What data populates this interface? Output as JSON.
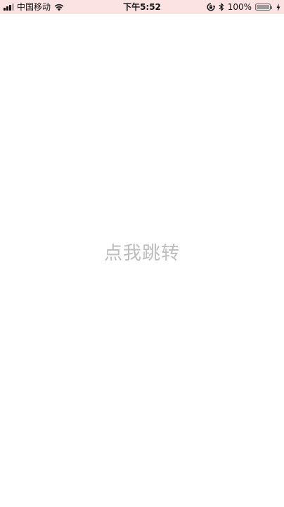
{
  "status_bar": {
    "carrier": "中国移动",
    "time": "下午5:52",
    "battery_percent": "100%",
    "signal_level": 3,
    "battery_level": 1.0,
    "icons": [
      "signal-icon",
      "wifi-icon",
      "rotation-lock-icon",
      "bluetooth-icon",
      "battery-icon",
      "charging-bolt-icon"
    ],
    "background_color": "#fbe3e3"
  },
  "main": {
    "jump_label": "点我跳转",
    "text_color": "#bdbdbd"
  }
}
